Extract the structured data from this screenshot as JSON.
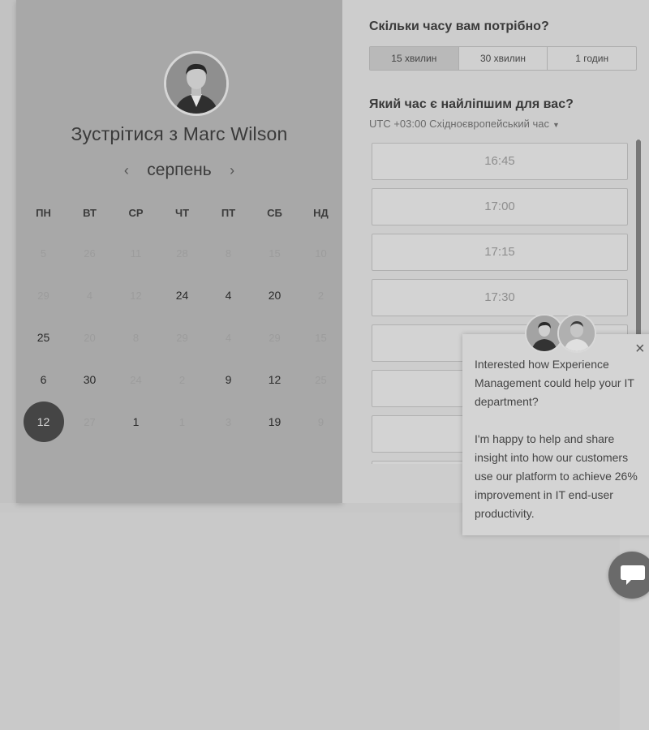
{
  "left": {
    "meet_title": "Зустрітися з Marc Wilson",
    "month": "серпень",
    "prev_icon": "‹",
    "next_icon": "›",
    "weekdays": [
      "ПН",
      "ВТ",
      "СР",
      "ЧТ",
      "ПТ",
      "СБ",
      "НД"
    ],
    "weeks": [
      [
        {
          "d": "5",
          "s": "dim"
        },
        {
          "d": "26",
          "s": "dim"
        },
        {
          "d": "11",
          "s": "dim"
        },
        {
          "d": "28",
          "s": "dim"
        },
        {
          "d": "8",
          "s": "dim"
        },
        {
          "d": "15",
          "s": "dim"
        },
        {
          "d": "10",
          "s": "dim"
        }
      ],
      [
        {
          "d": "29",
          "s": "dim"
        },
        {
          "d": "4",
          "s": "dim"
        },
        {
          "d": "12",
          "s": "dim"
        },
        {
          "d": "24",
          "s": "on"
        },
        {
          "d": "4",
          "s": "on"
        },
        {
          "d": "20",
          "s": "on"
        },
        {
          "d": "2",
          "s": "dim"
        }
      ],
      [
        {
          "d": "25",
          "s": "on"
        },
        {
          "d": "20",
          "s": "dim"
        },
        {
          "d": "8",
          "s": "dim"
        },
        {
          "d": "29",
          "s": "dim"
        },
        {
          "d": "4",
          "s": "dim"
        },
        {
          "d": "29",
          "s": "dim"
        },
        {
          "d": "15",
          "s": "dim"
        }
      ],
      [
        {
          "d": "6",
          "s": "on"
        },
        {
          "d": "30",
          "s": "on"
        },
        {
          "d": "24",
          "s": "dim"
        },
        {
          "d": "2",
          "s": "dim"
        },
        {
          "d": "9",
          "s": "on"
        },
        {
          "d": "12",
          "s": "on"
        },
        {
          "d": "25",
          "s": "dim"
        }
      ],
      [
        {
          "d": "12",
          "s": "sel"
        },
        {
          "d": "27",
          "s": "dim"
        },
        {
          "d": "1",
          "s": "on"
        },
        {
          "d": "1",
          "s": "dim"
        },
        {
          "d": "3",
          "s": "dim"
        },
        {
          "d": "19",
          "s": "on"
        },
        {
          "d": "9",
          "s": "dim"
        }
      ]
    ]
  },
  "right": {
    "duration_question": "Скільки часу вам потрібно?",
    "durations": [
      "15 хвилин",
      "30 хвилин",
      "1 годин"
    ],
    "time_question": "Який час є найліпшим для вас?",
    "timezone": "UTC +03:00 Східноєвропейський час",
    "slots": [
      "16:45",
      "17:00",
      "17:15",
      "17:30",
      "",
      "",
      "",
      ""
    ]
  },
  "chat": {
    "message_1": "Interested how Experience Management could help your IT department?",
    "message_2": "I'm happy to help and share insight into how our customers use our platform to achieve 26% improvement in IT end-user productivity.",
    "close_icon": "×"
  }
}
